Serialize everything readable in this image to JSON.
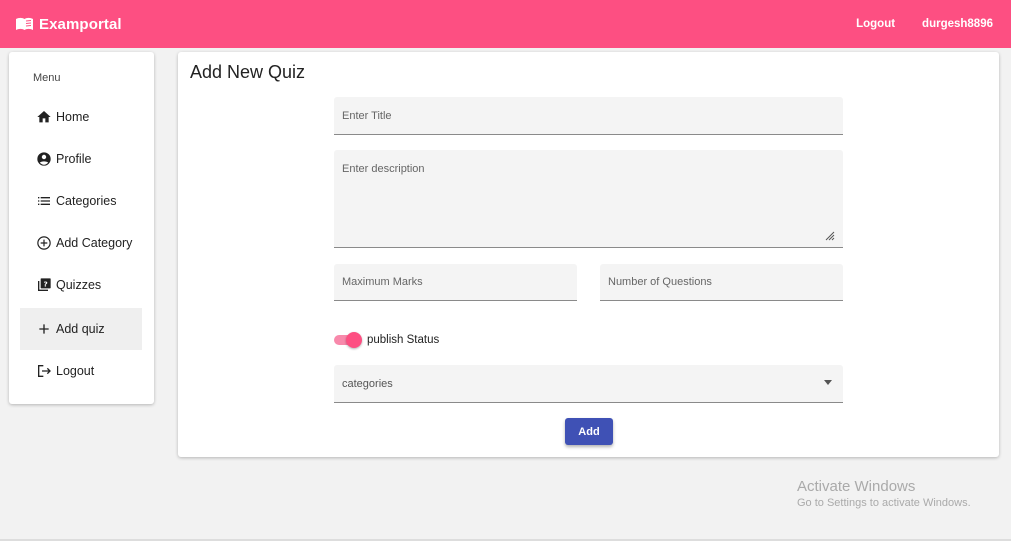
{
  "app": {
    "brand": "Examportal",
    "brand_icon": "book-open-icon"
  },
  "topnav": {
    "logout": "Logout",
    "username": "durgesh8896"
  },
  "sidebar": {
    "heading": "Menu",
    "items": [
      {
        "label": "Home",
        "icon": "home-icon"
      },
      {
        "label": "Profile",
        "icon": "account-circle-icon"
      },
      {
        "label": "Categories",
        "icon": "list-icon"
      },
      {
        "label": "Add Category",
        "icon": "add-circle-icon"
      },
      {
        "label": "Quizzes",
        "icon": "quiz-icon"
      },
      {
        "label": "Add quiz",
        "icon": "plus-icon",
        "active": true
      },
      {
        "label": "Logout",
        "icon": "logout-icon"
      }
    ]
  },
  "form": {
    "title": "Add New Quiz",
    "title_placeholder": "Enter Title",
    "description_placeholder": "Enter description",
    "max_marks_placeholder": "Maximum Marks",
    "num_questions_placeholder": "Number of Questions",
    "publish_label": "publish Status",
    "publish_on": true,
    "categories_label": "categories",
    "submit_label": "Add"
  },
  "watermark": {
    "title": "Activate Windows",
    "subtitle": "Go to Settings to activate Windows."
  },
  "colors": {
    "primary": "#fd4f82",
    "button": "#3f51b5",
    "toggle_track": "#f889ab"
  }
}
